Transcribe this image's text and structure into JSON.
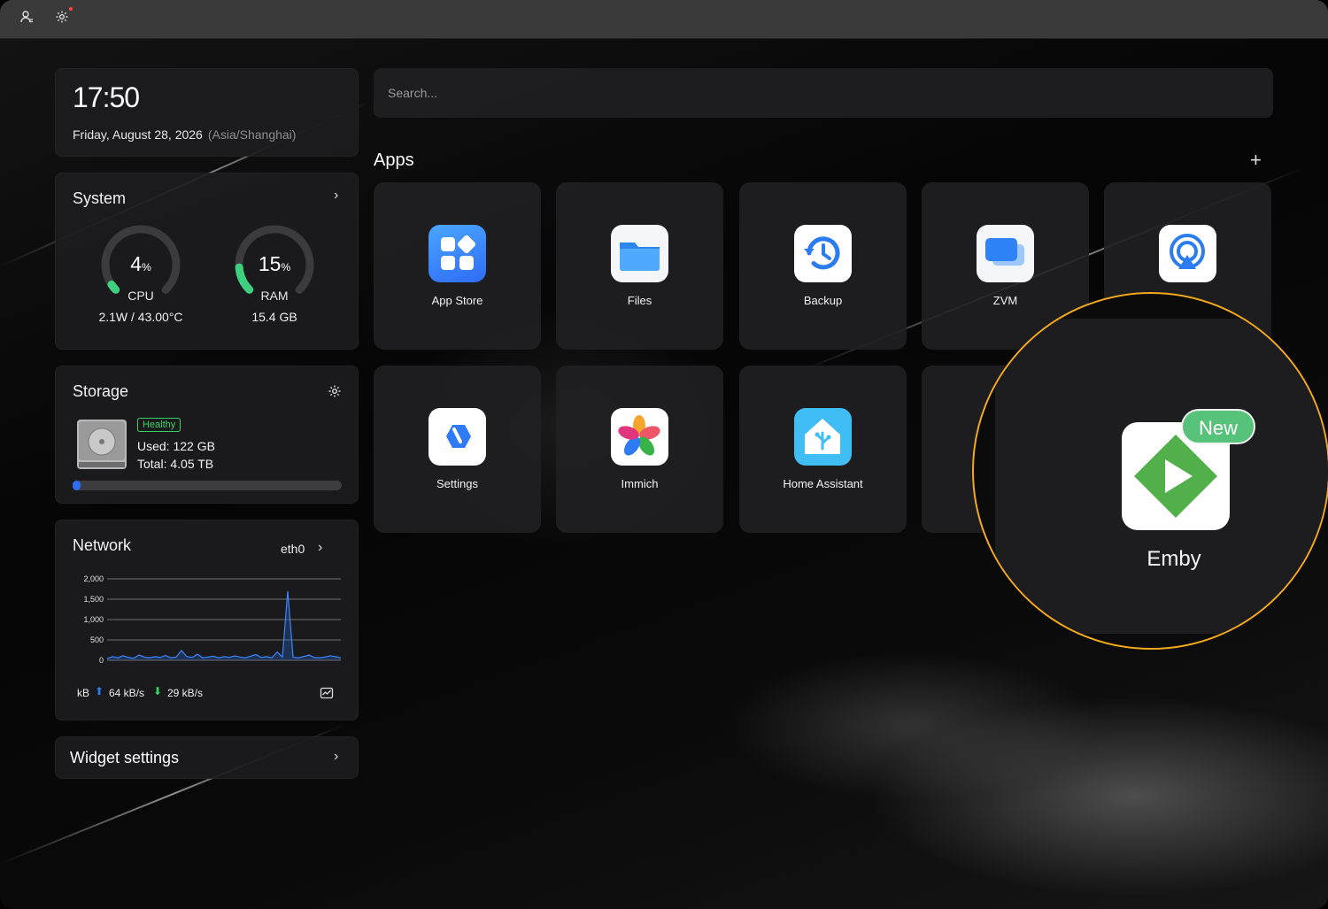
{
  "topbar": {
    "user_icon": "user-icon",
    "settings_icon": "gear-icon",
    "notification_dot_color": "#ff4a4a"
  },
  "clock": {
    "time": "17:50",
    "date": "Friday, August 28, 2026",
    "timezone": "(Asia/Shanghai)"
  },
  "system": {
    "title": "System",
    "cpu": {
      "value": "4",
      "unit": "%",
      "label": "CPU",
      "detail": "2.1W / 43.00°C",
      "percent": 4
    },
    "ram": {
      "value": "15",
      "unit": "%",
      "label": "RAM",
      "detail": "15.4 GB",
      "percent": 15
    },
    "gauge_color": "#3dd17f"
  },
  "storage": {
    "title": "Storage",
    "status": "Healthy",
    "used": "Used: 122 GB",
    "total": "Total: 4.05 TB",
    "used_fraction": 0.03
  },
  "network": {
    "title": "Network",
    "interface": "eth0",
    "footer_unit": "kB",
    "upload": "64 kB/s",
    "download": "29 kB/s",
    "chart_data": {
      "type": "area",
      "yticks": [
        "2,000",
        "1,500",
        "1,000",
        "500",
        "0"
      ],
      "ylim": [
        0,
        2000
      ],
      "grid": true,
      "values": [
        40,
        90,
        60,
        110,
        70,
        50,
        130,
        80,
        60,
        90,
        70,
        120,
        60,
        80,
        240,
        90,
        70,
        150,
        60,
        80,
        100,
        60,
        90,
        70,
        110,
        80,
        60,
        100,
        140,
        70,
        90,
        60,
        200,
        80,
        1700,
        80,
        60,
        90,
        130,
        70,
        60,
        80,
        110,
        90,
        60
      ]
    }
  },
  "widget_settings": {
    "label": "Widget settings"
  },
  "search": {
    "placeholder": "Search..."
  },
  "apps": {
    "title": "Apps",
    "items": [
      {
        "label": "App Store"
      },
      {
        "label": "Files"
      },
      {
        "label": "Backup"
      },
      {
        "label": "ZVM"
      },
      {
        "label": "Settings"
      },
      {
        "label": "Immich"
      },
      {
        "label": "Home Assistant"
      }
    ]
  },
  "highlight": {
    "label": "Emby",
    "badge": "New",
    "ring_color": "#f3a81b",
    "badge_color": "#56c27a"
  }
}
